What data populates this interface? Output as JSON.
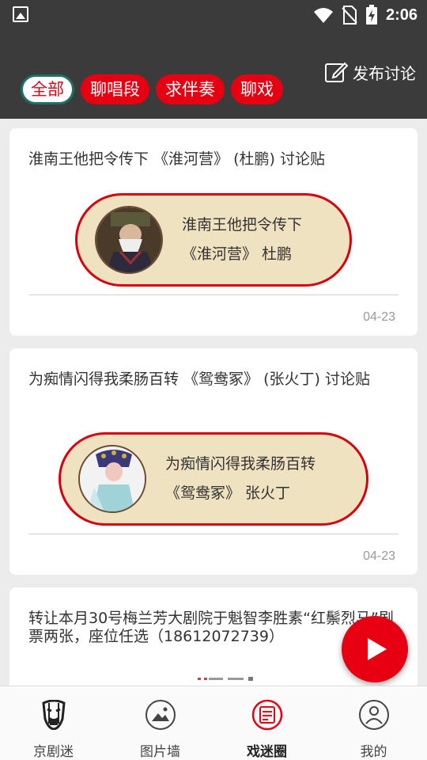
{
  "status_bar": {
    "time": "2:06"
  },
  "header": {
    "post_label": "发布讨论",
    "tabs": [
      {
        "label": "全部",
        "active": true
      },
      {
        "label": "聊唱段",
        "active": false
      },
      {
        "label": "求伴奏",
        "active": false
      },
      {
        "label": "聊戏",
        "active": false
      }
    ]
  },
  "posts": [
    {
      "title": "淮南王他把令传下 《淮河营》 (杜鹏) 讨论贴",
      "pill_line1": "淮南王他把令传下",
      "pill_line2": "《淮河营》 杜鹏",
      "date": "04-23"
    },
    {
      "title": "为痴情闪得我柔肠百转 《鸳鸯冢》 (张火丁) 讨论贴",
      "pill_line1": "为痴情闪得我柔肠百转",
      "pill_line2": "《鸳鸯冢》 张火丁",
      "date": "04-23"
    },
    {
      "title": "转让本月30号梅兰芳大剧院于魁智李胜素“红鬃烈马”剧票两张，座位任选（18612072739）"
    }
  ],
  "bottom_nav": [
    {
      "label": "京剧迷",
      "icon": "opera-mask-icon",
      "active": false
    },
    {
      "label": "图片墙",
      "icon": "image-icon",
      "active": false
    },
    {
      "label": "戏迷圈",
      "icon": "chat-circle-icon",
      "active": true
    },
    {
      "label": "我的",
      "icon": "user-icon",
      "active": false
    }
  ],
  "colors": {
    "accent": "#e60012",
    "header_bg": "#3b3b3b",
    "pill_bg": "#efe2c0"
  }
}
